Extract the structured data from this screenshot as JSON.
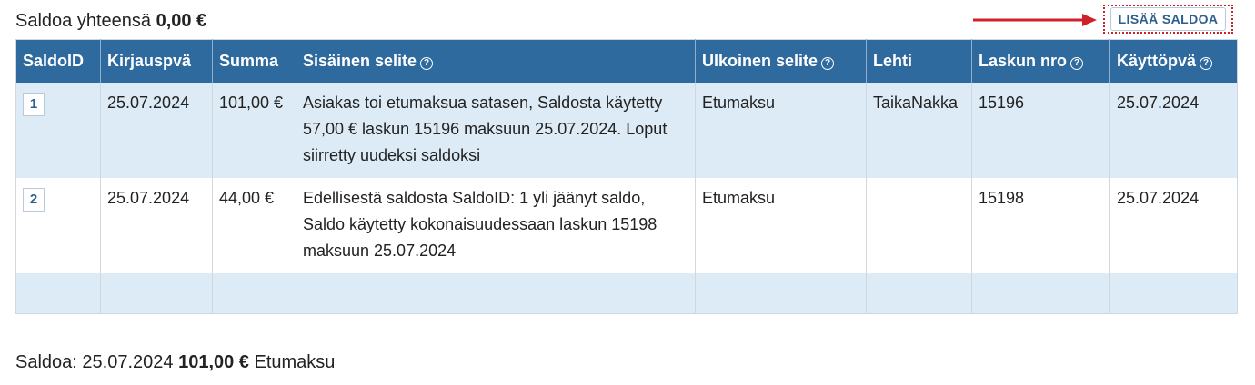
{
  "header": {
    "title_prefix": "Saldoa yhteensä",
    "total": "0,00 €",
    "add_button": "LISÄÄ SALDOA"
  },
  "colors": {
    "header_bg": "#2e6a9e",
    "row_alt_bg": "#dcebf6",
    "accent_red": "#d0202a"
  },
  "table": {
    "columns": [
      "SaldoID",
      "Kirjauspvä",
      "Summa",
      "Sisäinen selite",
      "Ulkoinen selite",
      "Lehti",
      "Laskun nro",
      "Käyttöpvä"
    ],
    "help_icon": "?",
    "rows": [
      {
        "id": "1",
        "kirjauspva": "25.07.2024",
        "summa": "101,00 €",
        "sisainen": "Asiakas toi etumaksua satasen, Saldosta käytetty 57,00 € laskun 15196 maksuun 25.07.2024. Loput siirretty uudeksi saldoksi",
        "ulkoinen": "Etumaksu",
        "lehti": "TaikaNakka",
        "laskun_nro": "15196",
        "kayttopva": "25.07.2024"
      },
      {
        "id": "2",
        "kirjauspva": "25.07.2024",
        "summa": "44,00 €",
        "sisainen": "Edellisestä saldosta SaldoID: 1 yli jäänyt saldo, Saldo käytetty kokonaisuudessaan laskun 15198 maksuun 25.07.2024",
        "ulkoinen": "Etumaksu",
        "lehti": "",
        "laskun_nro": "15198",
        "kayttopva": "25.07.2024"
      }
    ]
  },
  "footer": {
    "prefix": "Saldoa:",
    "date": "25.07.2024",
    "amount": "101,00 €",
    "label": "Etumaksu"
  }
}
